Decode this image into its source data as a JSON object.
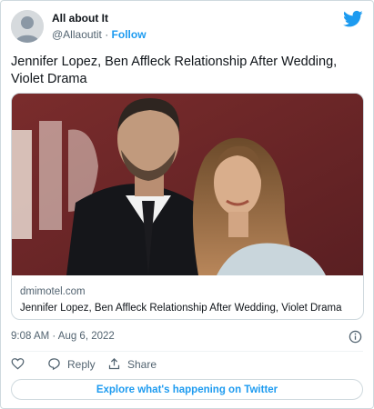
{
  "author": {
    "name": "All about It",
    "handle": "@Allaoutit",
    "separator": " · ",
    "follow_label": "Follow"
  },
  "tweet": {
    "text": "Jennifer Lopez, Ben Affleck Relationship After Wedding, Violet Drama"
  },
  "link_card": {
    "domain": "dmimotel.com",
    "title": "Jennifer Lopez, Ben Affleck Relationship After Wedding, Violet Drama"
  },
  "meta": {
    "timestamp": "9:08 AM · Aug 6, 2022"
  },
  "actions": {
    "like_icon": "heart-icon",
    "reply_label": "Reply",
    "share_label": "Share"
  },
  "cta": {
    "explore_label": "Explore what's happening on Twitter"
  },
  "colors": {
    "accent": "#1d9bf0",
    "text": "#0f1419",
    "muted": "#536471",
    "border": "#cfd9de"
  }
}
